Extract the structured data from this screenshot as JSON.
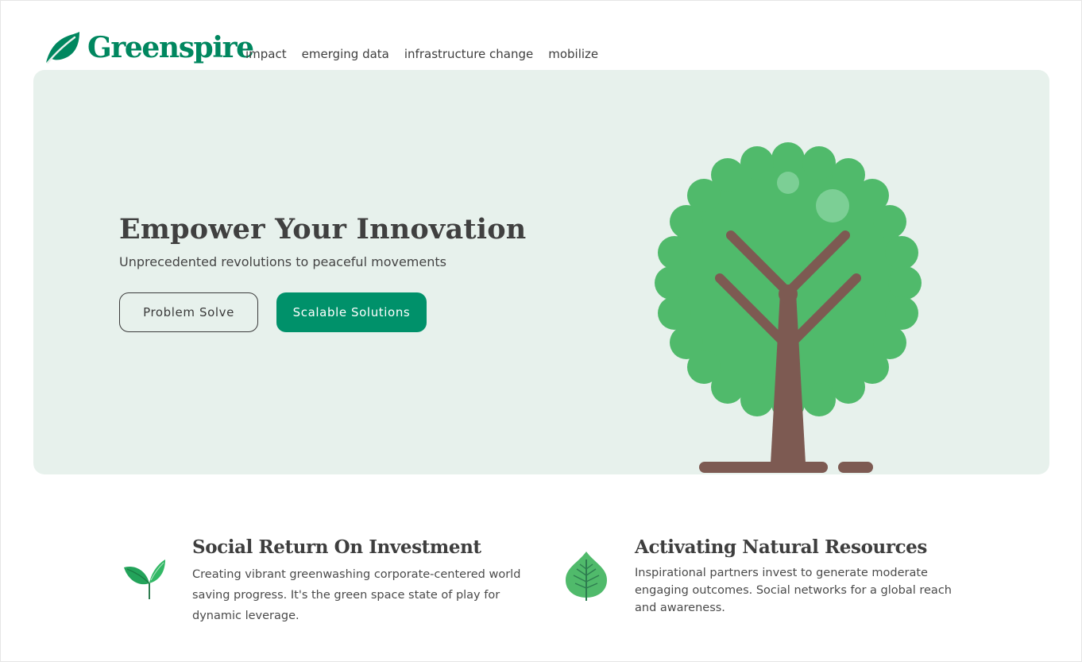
{
  "brand": {
    "name": "Greenspire",
    "color": "#00875f"
  },
  "nav": {
    "items": [
      "impact",
      "emerging data",
      "infrastructure change",
      "mobilize"
    ]
  },
  "hero": {
    "title": "Empower Your Innovation",
    "subtitle": "Unprecedented revolutions to peaceful movements",
    "primary_button": "Scalable Solutions",
    "secondary_button": "Problem Solve",
    "background": "#e7f1ec",
    "accent": "#00916a",
    "illustration": "tree-illustration"
  },
  "features": [
    {
      "icon": "sprout-icon",
      "title": "Social Return On Investment",
      "text": "Creating vibrant greenwashing corporate-centered world saving progress. It's the green space state of play for dynamic leverage."
    },
    {
      "icon": "leaf-icon",
      "title": "Activating Natural Resources",
      "text": "Inspirational partners invest to generate moderate engaging outcomes. Social networks for a global reach and awareness."
    }
  ]
}
